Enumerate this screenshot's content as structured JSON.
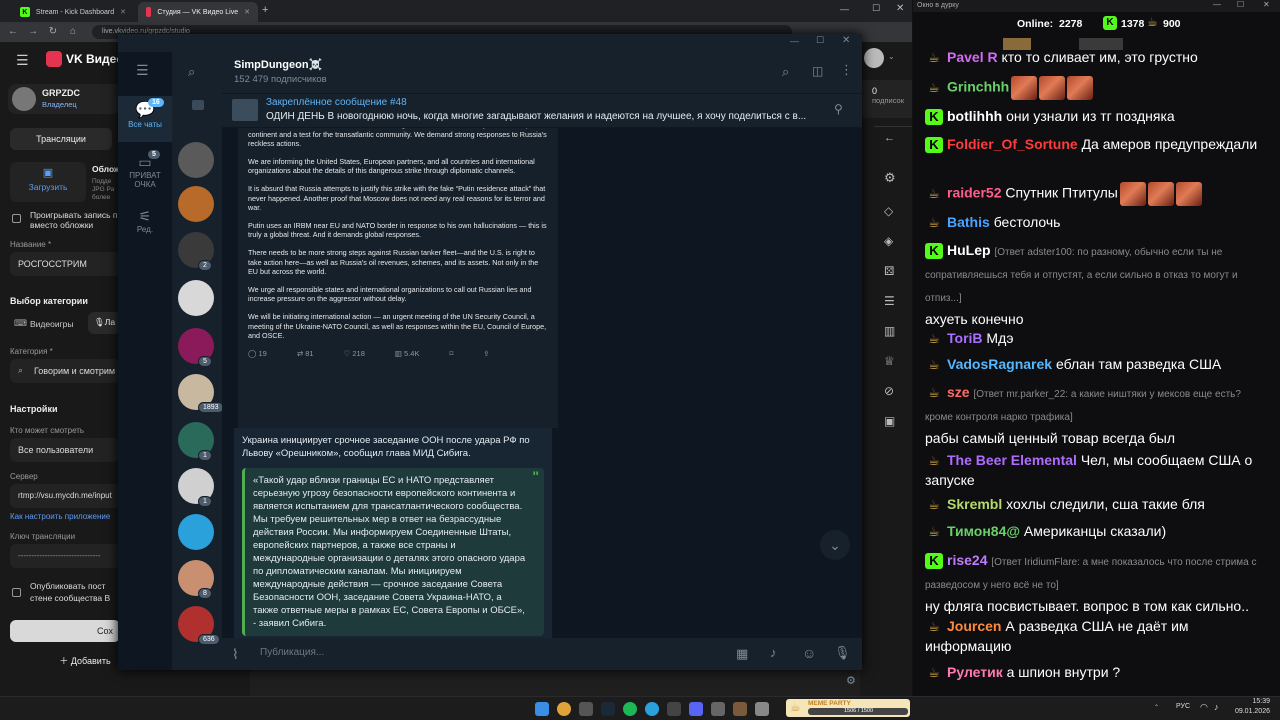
{
  "browser": {
    "tabs": [
      {
        "label": "Stream - Kick Dashboard",
        "kind": "kick"
      },
      {
        "label": "Студия — VK Видео Live",
        "kind": "vk"
      }
    ],
    "url": "live.vkvideo.ru/grpzdc/studio"
  },
  "vk": {
    "logo": "VK Видео",
    "profile_name": "GRPZDC",
    "profile_role": "Владелец",
    "tab_streams": "Трансляции",
    "upload_label": "Загрузить",
    "cover_title": "Облож",
    "cover_hint": "Подде\nJPG Ра\nболее",
    "record_label": "Проигрывать запись п\nвместо обложки",
    "name_label": "Название *",
    "name_value": "РОСГОССТРИМ",
    "category_heading": "Выбор категории",
    "cat_games": "Видеоигры",
    "cat_live": "Ла",
    "category_label": "Категория *",
    "category_value": "Говорим и смотрим",
    "settings_heading": "Настройки",
    "who_label": "Кто может смотреть",
    "who_value": "Все пользователи",
    "server_label": "Сервер",
    "server_value": "rtmp://vsu.mycdn.me/input",
    "howto_link": "Как настроить приложение",
    "key_label": "Ключ трансляции",
    "key_value": "-------------------------------",
    "publish_label": "Опубликовать пост\nстене сообщества В",
    "save_label": "Сох",
    "add_label": "Добавить",
    "right_count": "0",
    "right_label": "подписок"
  },
  "telegram": {
    "folders": [
      {
        "label": "Все чаты",
        "badge": "16",
        "icon": "chat-bubble-icon"
      },
      {
        "label": "ПРИВАТ ОЧКА",
        "badge": "5",
        "icon": "chat-bubble-icon"
      },
      {
        "label": "Ред.",
        "badge": "",
        "icon": "sliders-icon"
      }
    ],
    "chat_badges": [
      "",
      "",
      "2",
      "",
      "5",
      "1893",
      "1",
      "1",
      "",
      "8",
      "636",
      ""
    ],
    "channel_name": "SimpDungeon☠️",
    "subscribers": "152 479 подписчиков",
    "pinned_title": "Закреплённое сообщение #48",
    "pinned_text": "ОДИН ДЕНЬ  В новогоднюю ночь, когда многие загадывают желания и надеются на лучшее, я хочу поделиться с в...",
    "tweet_paragraphs": [
      "Such a strike close to EU and NATO border is a grave threat to the security on the European continent and a test for the transatlantic community. We demand strong responses to Russia's reckless actions.",
      "We are informing the United States, European partners, and all countries and international organizations about the details of this dangerous strike through diplomatic channels.",
      "It is absurd that Russia attempts to justify this strike with the fake “Putin residence attack” that never happened. Another proof that Moscow does not need any real reasons for its terror and war.",
      "Putin uses an IRBM near EU and NATO border in response to his own hallucinations — this is truly a global threat. And it demands global responses.",
      "There needs to be more strong steps against Russian tanker fleet—and the U.S. is right to take action here—as well as Russia's oil revenues, schemes, and its assets. Not only in the EU but across the world.",
      "We urge all responsible states and international organizations to call out Russian lies and increase pressure on the aggressor without delay.",
      "We will be initiating international action — an urgent meeting of the UN Security Council, a meeting of the Ukraine-NATO Council, as well as responses within the EU, Council of Europe, and OSCE."
    ],
    "tweet_stats": {
      "replies": "19",
      "retweets": "81",
      "likes": "218",
      "views": "5.4K"
    },
    "message_text": "Украина инициирует срочное заседание ООН после удара РФ по Львову «Орешником», сообщил глава МИД Сибига.",
    "quote_text": "«Такой удар вблизи границы ЕС и НАТО представляет серьезную угрозу безопасности европейского континента и является испытанием для трансатлантического сообщества. Мы требуем решительных мер в ответ на безрассудные действия России. Мы информируем Соединенные Штаты, европейских партнеров, а также все страны и международные организации о деталях этого опасного удара по дипломатическим каналам. Мы инициируем международные действия — срочное заседание Совета Безопасности ООН, заседание Совета Украина-НАТО, а также ответные меры в рамках ЕС, Совета Европы и ОБСЕ», - заявил Сибига.",
    "compose_placeholder": "Публикация..."
  },
  "chat": {
    "window_title": "Окно в дурку",
    "online_label": "Online:",
    "online_value": "2278",
    "kick_count": "1378",
    "cup_count": "900",
    "messages": [
      {
        "badge": "cup",
        "name": "Pavel R",
        "color": "#d56bf5",
        "reply": "",
        "text": "кто то сливает им, это грустно",
        "emotes": 0
      },
      {
        "badge": "cup",
        "name": "Grinchhh",
        "color": "#6ad06a",
        "reply": "",
        "text": "",
        "emotes": 3
      },
      {
        "badge": "kick",
        "name": "botlihhh",
        "color": "#ffffff",
        "reply": "",
        "text": "они узнали из тг поздняка",
        "emotes": 0
      },
      {
        "badge": "kick",
        "name": "Foldier_Of_Sortune",
        "color": "#ff3b3b",
        "reply": "",
        "text": "Да амеров предупреждали",
        "emotes": 0
      },
      {
        "badge": "cup",
        "name": "raider52",
        "color": "#ff5e8a",
        "reply": "",
        "text": "Спутник Птитулы",
        "emotes": 3
      },
      {
        "badge": "cup",
        "name": "Bathis",
        "color": "#4aa3ff",
        "reply": "",
        "text": "бестолочь",
        "emotes": 0
      },
      {
        "badge": "kick",
        "name": "HuLep",
        "color": "#ffffff",
        "reply": "[Ответ adster100: по разному, обычно если ты не сопративляешься тебя и отпустят, а если сильно в отказ то могут и отпиз...]",
        "text": "ахуеть конечно",
        "emotes": 0
      },
      {
        "badge": "cup",
        "name": "ToriB",
        "color": "#a970ff",
        "reply": "",
        "text": "Мдэ",
        "emotes": 0
      },
      {
        "badge": "cup",
        "name": "VadosRagnarek",
        "color": "#56b7ff",
        "reply": "",
        "text": "еблан там разведка США",
        "emotes": 0
      },
      {
        "badge": "cup",
        "name": "sze",
        "color": "#ff6a6a",
        "reply": "[Ответ mr.parker_22: а какие ништяки у мексов еще есть? кроме контроля нарко трафика]",
        "text": "рабы самый ценный товар всегда был",
        "emotes": 0
      },
      {
        "badge": "cup",
        "name": "The Beer Elemental",
        "color": "#b06cff",
        "reply": "",
        "text": "Чел, мы сообщаем США о запуске",
        "emotes": 0
      },
      {
        "badge": "cup",
        "name": "Skrembl",
        "color": "#b5d96a",
        "reply": "",
        "text": "хохлы следили, сша такие бля",
        "emotes": 0
      },
      {
        "badge": "cup",
        "name": "Тимон84@",
        "color": "#6ad06a",
        "reply": "",
        "text": "Американцы сказали)",
        "emotes": 0
      },
      {
        "badge": "kick",
        "name": "rise24",
        "color": "#c07cff",
        "reply": "[Ответ IridiumFlare: а мне показалось что после стрима с разведосом у него всё не то]",
        "text": "ну фляга посвистывает. вопрос в том как сильно..",
        "emotes": 0
      },
      {
        "badge": "cup",
        "name": "Jourcen",
        "color": "#ff8a3d",
        "reply": "",
        "text": "А разведка США не даёт им информацию",
        "emotes": 0
      },
      {
        "badge": "cup",
        "name": "Рулетик",
        "color": "#ff7ab0",
        "reply": "",
        "text": "а шпион внутри ?",
        "emotes": 0
      }
    ]
  },
  "taskbar": {
    "widget_title": "MEME PARTY",
    "widget_progress": "1506 / 1500",
    "lang": "РУС",
    "time": "15:39",
    "date": "09.01.2026"
  }
}
